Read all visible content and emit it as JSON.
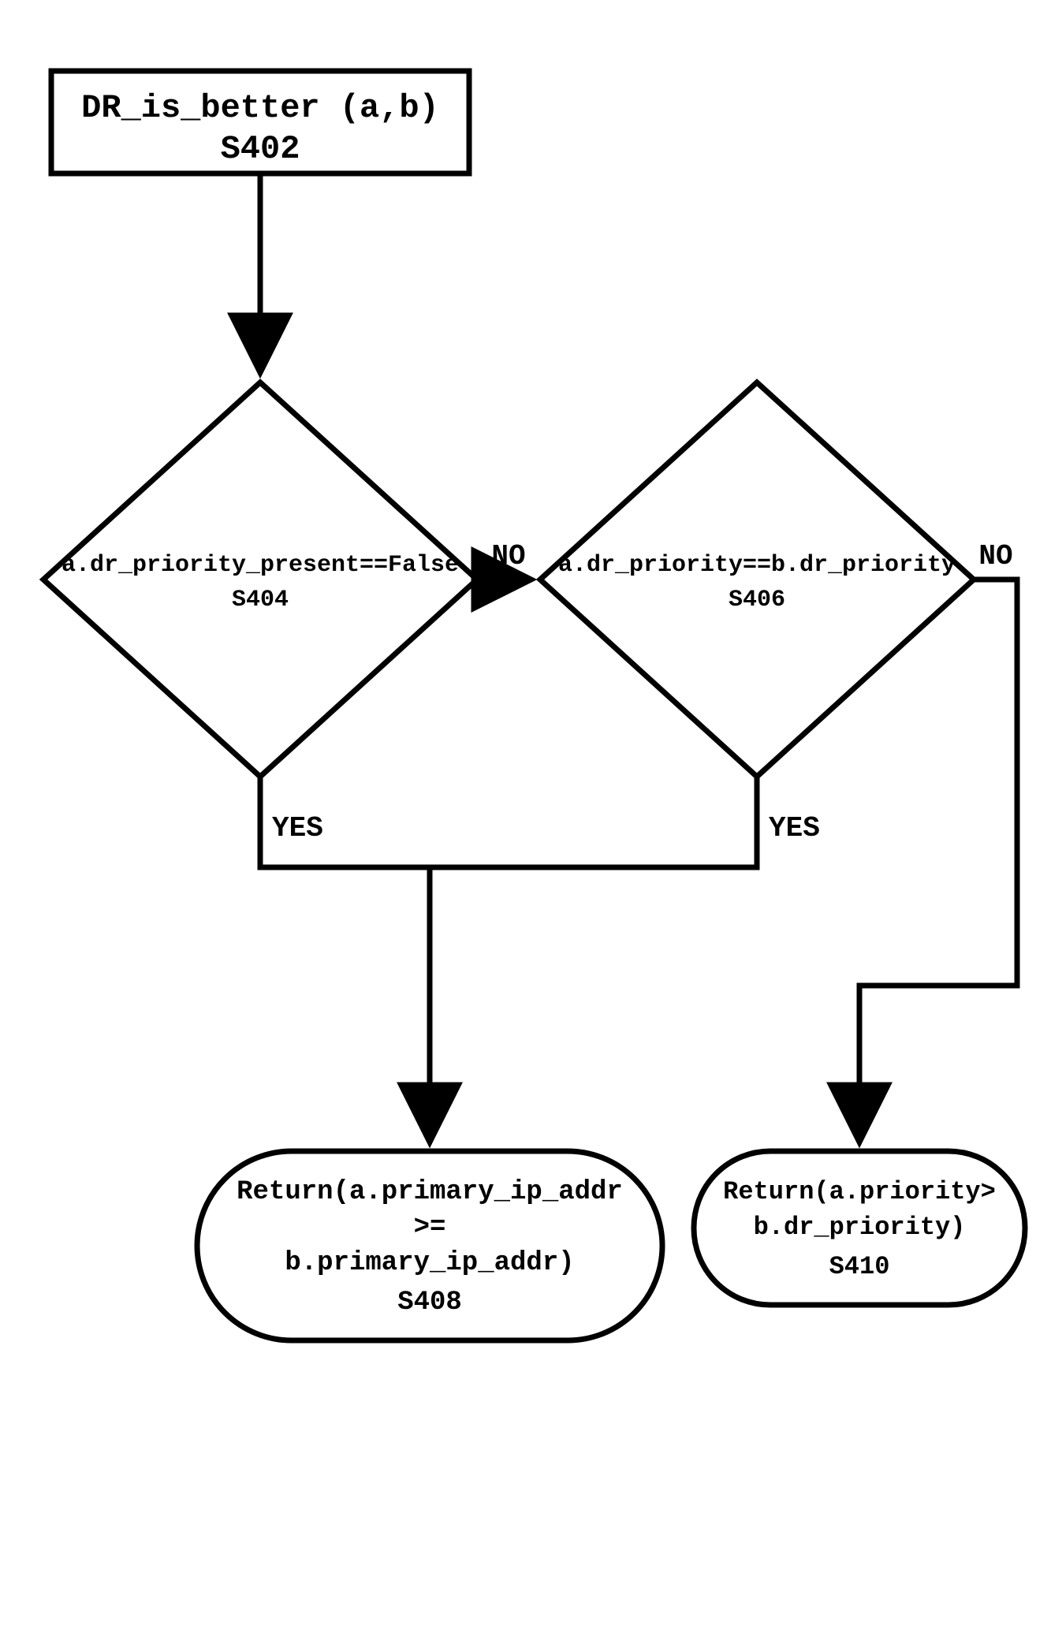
{
  "chart_data": {
    "type": "flowchart",
    "nodes": [
      {
        "id": "S402",
        "shape": "rect",
        "label_line1": "DR_is_better (a,b)",
        "label_line2": "S402"
      },
      {
        "id": "S404",
        "shape": "diamond",
        "label_line1": "a.dr_priority_present==False",
        "label_line2": "S404"
      },
      {
        "id": "S406",
        "shape": "diamond",
        "label_line1": "a.dr_priority==b.dr_priority",
        "label_line2": "S406"
      },
      {
        "id": "S408",
        "shape": "terminator",
        "label_line1": "Return(a.primary_ip_addr",
        "label_line2": ">=",
        "label_line3": "b.primary_ip_addr)",
        "label_line4": "S408"
      },
      {
        "id": "S410",
        "shape": "terminator",
        "label_line1": "Return(a.priority>",
        "label_line2": "b.dr_priority)",
        "label_line3": "S410"
      }
    ],
    "edges": [
      {
        "from": "S402",
        "to": "S404"
      },
      {
        "from": "S404",
        "to": "S406",
        "label": "NO"
      },
      {
        "from": "S404",
        "to": "S408",
        "label": "YES"
      },
      {
        "from": "S406",
        "to": "S408",
        "label": "YES"
      },
      {
        "from": "S406",
        "to": "S410",
        "label": "NO"
      }
    ]
  },
  "nodes": {
    "s402": {
      "l1": "DR_is_better (a,b)",
      "l2": "S402"
    },
    "s404": {
      "l1": "a.dr_priority_present==False",
      "l2": "S404"
    },
    "s406": {
      "l1": "a.dr_priority==b.dr_priority",
      "l2": "S406"
    },
    "s408": {
      "l1": "Return(a.primary_ip_addr",
      "l2": ">=",
      "l3": "b.primary_ip_addr)",
      "l4": "S408"
    },
    "s410": {
      "l1": "Return(a.priority>",
      "l2": "b.dr_priority)",
      "l3": "S410"
    }
  },
  "labels": {
    "no": "NO",
    "yes": "YES"
  }
}
